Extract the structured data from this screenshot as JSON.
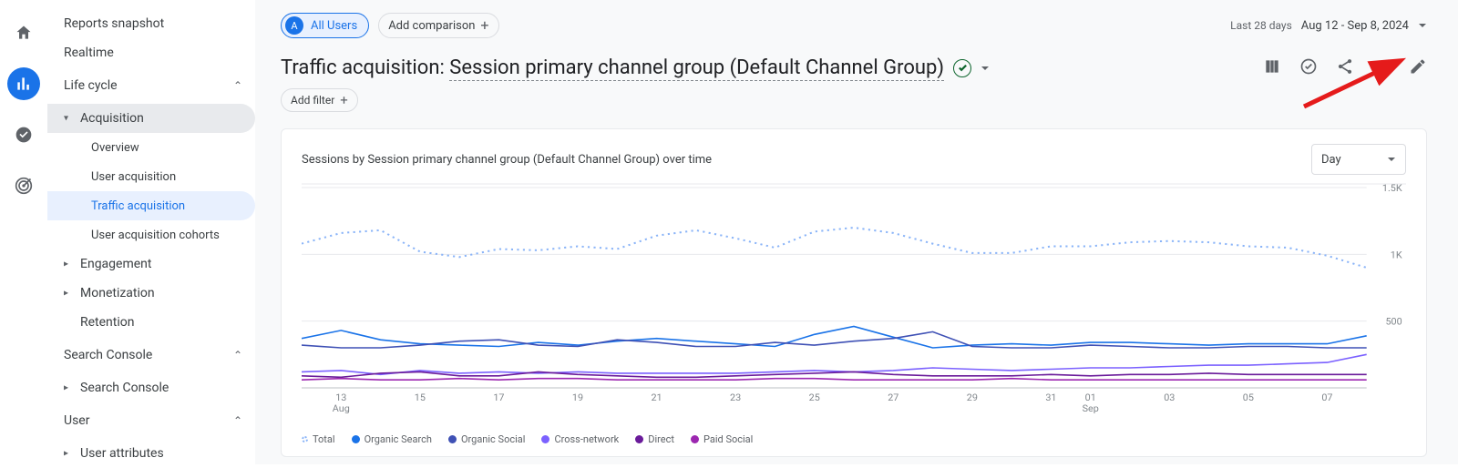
{
  "iconrail": [
    {
      "name": "home-icon",
      "kind": "home",
      "active": false
    },
    {
      "name": "reports-icon",
      "kind": "barchart",
      "active": true
    },
    {
      "name": "explore-icon",
      "kind": "checkcircle",
      "active": false
    },
    {
      "name": "advertising-icon",
      "kind": "target",
      "active": false
    }
  ],
  "sidenav": {
    "top_items": [
      "Reports snapshot",
      "Realtime"
    ],
    "sections": [
      {
        "label": "Life cycle",
        "expanded": true,
        "groups": [
          {
            "label": "Acquisition",
            "expanded": true,
            "items": [
              "Overview",
              "User acquisition",
              "Traffic acquisition",
              "User acquisition cohorts"
            ],
            "selected": "Traffic acquisition"
          },
          {
            "label": "Engagement",
            "expanded": false,
            "items": []
          },
          {
            "label": "Monetization",
            "expanded": false,
            "items": []
          },
          {
            "label": "Retention",
            "expanded": false,
            "items": [],
            "leaf": true
          }
        ]
      },
      {
        "label": "Search Console",
        "expanded": true,
        "groups": [
          {
            "label": "Search Console",
            "expanded": false,
            "items": []
          }
        ]
      },
      {
        "label": "User",
        "expanded": true,
        "groups": [
          {
            "label": "User attributes",
            "expanded": false,
            "items": []
          }
        ]
      }
    ]
  },
  "comparison_chip": {
    "bubble": "A",
    "label": "All Users"
  },
  "add_comparison_label": "Add comparison",
  "daterange": {
    "period": "Last 28 days",
    "range": "Aug 12 - Sep 8, 2024"
  },
  "page_title_prefix": "Traffic acquisition: ",
  "page_title_dimension": "Session primary channel group (Default Channel Group)",
  "add_filter_label": "Add filter",
  "toolbar_icons": [
    {
      "name": "compare-icon",
      "kind": "columns"
    },
    {
      "name": "data-quality-icon",
      "kind": "checkcircle2"
    },
    {
      "name": "share-icon",
      "kind": "share"
    },
    {
      "name": "insights-icon",
      "kind": "spark"
    },
    {
      "name": "edit-icon",
      "kind": "pencil"
    }
  ],
  "card": {
    "title": "Sessions by Session primary channel group (Default Channel Group) over time",
    "granularity": "Day"
  },
  "chart_data": {
    "type": "line",
    "x": [
      "12",
      "13",
      "14",
      "15",
      "16",
      "17",
      "18",
      "19",
      "20",
      "21",
      "22",
      "23",
      "24",
      "25",
      "26",
      "27",
      "28",
      "29",
      "30",
      "31",
      "01",
      "02",
      "03",
      "04",
      "05",
      "06",
      "07",
      "08"
    ],
    "x_labels_shown": [
      "13",
      "15",
      "17",
      "19",
      "21",
      "23",
      "25",
      "27",
      "29",
      "31",
      "01",
      "03",
      "05",
      "07"
    ],
    "x_caption_left": "Aug",
    "x_caption_right": "Sep",
    "ylim": [
      0,
      1500
    ],
    "yticks": [
      500,
      1000,
      1500
    ],
    "ytick_labels": [
      "500",
      "1K",
      "1.5K"
    ],
    "series": [
      {
        "name": "Total",
        "style": "dotted",
        "color": "#8ab4f8",
        "values": [
          1080,
          1160,
          1180,
          1020,
          980,
          1040,
          1030,
          1060,
          1040,
          1140,
          1180,
          1120,
          1050,
          1170,
          1200,
          1160,
          1080,
          1010,
          1010,
          1060,
          1060,
          1090,
          1100,
          1090,
          1060,
          1050,
          990,
          900
        ]
      },
      {
        "name": "Organic Search",
        "style": "solid",
        "color": "#1a73e8",
        "values": [
          370,
          430,
          360,
          330,
          320,
          310,
          340,
          320,
          350,
          370,
          350,
          330,
          310,
          400,
          460,
          380,
          300,
          320,
          330,
          320,
          340,
          340,
          330,
          320,
          330,
          330,
          330,
          390
        ]
      },
      {
        "name": "Organic Social",
        "style": "solid",
        "color": "#3f51b5",
        "values": [
          320,
          300,
          300,
          320,
          350,
          360,
          320,
          310,
          360,
          340,
          310,
          310,
          340,
          320,
          350,
          370,
          420,
          310,
          300,
          300,
          320,
          310,
          300,
          300,
          310,
          310,
          300,
          300
        ]
      },
      {
        "name": "Cross-network",
        "style": "solid",
        "color": "#7b61ff",
        "values": [
          120,
          130,
          100,
          130,
          110,
          120,
          110,
          120,
          110,
          110,
          110,
          110,
          120,
          130,
          120,
          130,
          150,
          140,
          130,
          140,
          150,
          150,
          160,
          170,
          170,
          180,
          190,
          250
        ]
      },
      {
        "name": "Direct",
        "style": "solid",
        "color": "#6a1b9a",
        "values": [
          90,
          80,
          110,
          120,
          90,
          90,
          120,
          100,
          90,
          80,
          80,
          90,
          100,
          110,
          120,
          100,
          90,
          90,
          90,
          100,
          90,
          100,
          100,
          110,
          100,
          100,
          100,
          100
        ]
      },
      {
        "name": "Paid Social",
        "style": "solid",
        "color": "#9c27b0",
        "values": [
          60,
          70,
          60,
          60,
          70,
          60,
          70,
          70,
          60,
          60,
          60,
          60,
          70,
          70,
          60,
          60,
          60,
          60,
          70,
          60,
          60,
          60,
          60,
          60,
          60,
          60,
          60,
          60
        ]
      }
    ],
    "legend": [
      "Total",
      "Organic Search",
      "Organic Social",
      "Cross-network",
      "Direct",
      "Paid Social"
    ]
  }
}
